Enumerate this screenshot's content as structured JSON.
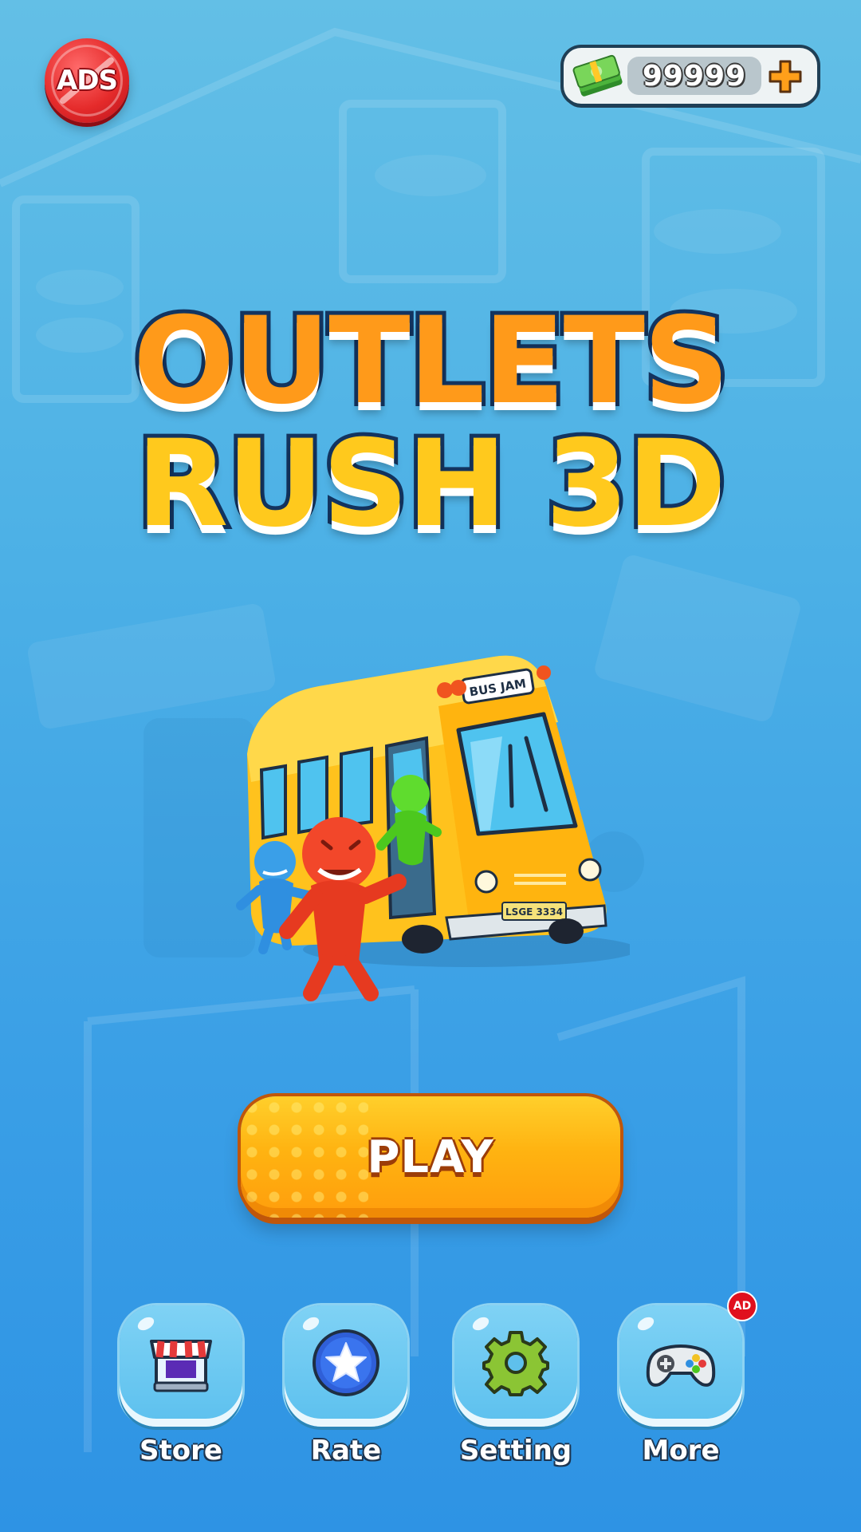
{
  "top_bar": {
    "ads_label": "ADS",
    "cash_value": "99999",
    "cash_icon": "cash-stack-icon",
    "add_icon": "plus-icon"
  },
  "title": {
    "line1": "OUTLETS",
    "line2": "RUSH 3D"
  },
  "hero": {
    "bus_sign": "BUS JAM",
    "license_plate": "LSGE 3334"
  },
  "play": {
    "label": "PLAY"
  },
  "nav": {
    "items": [
      {
        "label": "Store",
        "icon": "shop-icon"
      },
      {
        "label": "Rate",
        "icon": "star-icon"
      },
      {
        "label": "Setting",
        "icon": "gear-icon"
      },
      {
        "label": "More",
        "icon": "gamepad-icon",
        "badge": "AD"
      }
    ]
  },
  "colors": {
    "background_top": "#63bfe6",
    "background_bottom": "#2e93e4",
    "title_orange": "#ff9a1a",
    "title_yellow": "#ffc91d",
    "title_outline": "#13345f",
    "play_button": "#ffb311",
    "ads_red": "#e52b2b"
  }
}
